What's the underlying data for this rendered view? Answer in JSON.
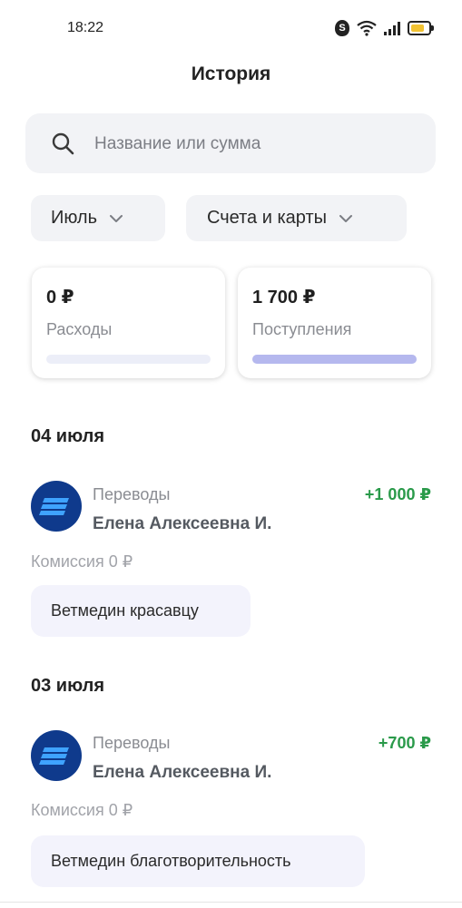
{
  "status_bar": {
    "time": "18:22"
  },
  "header": {
    "title": "История"
  },
  "search": {
    "placeholder": "Название или сумма"
  },
  "filters": {
    "month": "Июль",
    "accounts": "Счета и карты"
  },
  "summary": {
    "expenses": {
      "amount": "0 ₽",
      "label": "Расходы",
      "fill": 0
    },
    "income": {
      "amount": "1 700 ₽",
      "label": "Поступления",
      "fill": 1
    }
  },
  "groups": [
    {
      "date": "04 июля",
      "transactions": [
        {
          "category": "Переводы",
          "name": "Елена Алексеевна И.",
          "amount": "+1 000 ₽",
          "fee": "Комиссия 0 ₽",
          "comment": "Ветмедин красавцу"
        }
      ]
    },
    {
      "date": "03 июля",
      "transactions": [
        {
          "category": "Переводы",
          "name": "Елена Алексеевна И.",
          "amount": "+700 ₽",
          "fee": "Комиссия 0 ₽",
          "comment": "Ветмедин благотворительность"
        }
      ]
    }
  ],
  "colors": {
    "income_green": "#2a9a4a",
    "avatar_blue": "#0f3a8c",
    "bar_fill": "#b5b8ee"
  }
}
